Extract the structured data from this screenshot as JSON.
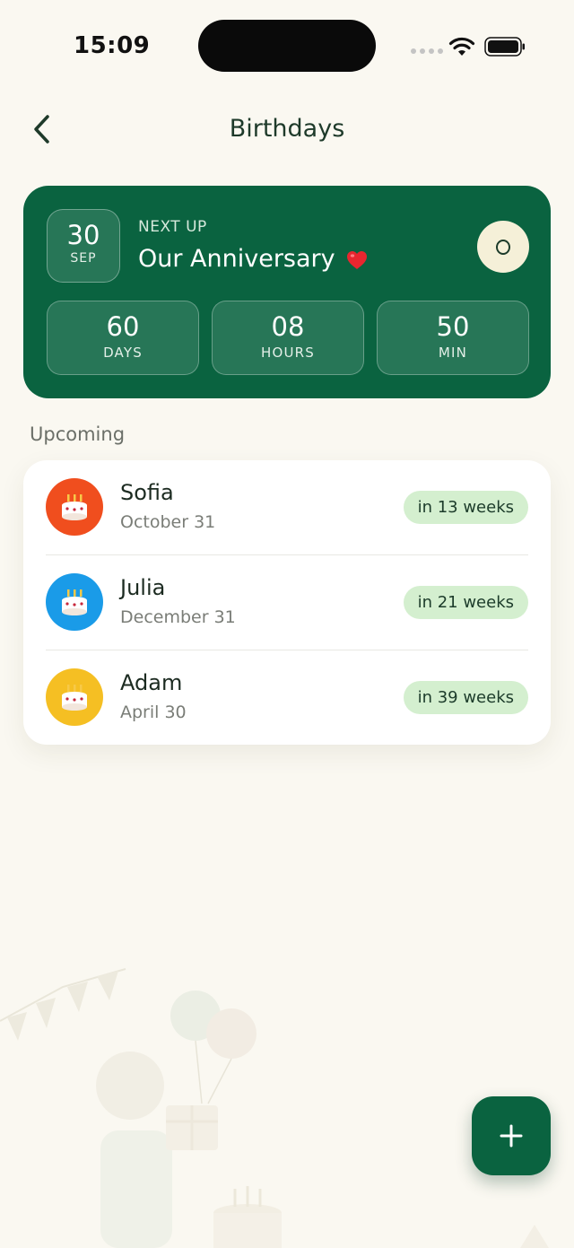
{
  "status_bar": {
    "time": "15:09"
  },
  "header": {
    "title": "Birthdays",
    "back_icon": "chevron-left-icon"
  },
  "next_up": {
    "day": "30",
    "month": "SEP",
    "label": "NEXT UP",
    "title": "Our Anniversary",
    "title_emoji": "heart-icon",
    "countdown": [
      {
        "value": "60",
        "unit": "DAYS"
      },
      {
        "value": "08",
        "unit": "HOURS"
      },
      {
        "value": "50",
        "unit": "MIN"
      }
    ]
  },
  "upcoming": {
    "label": "Upcoming",
    "items": [
      {
        "name": "Sofia",
        "date": "October 31",
        "badge": "in 13 weeks",
        "avatar_color": "#f04e1e"
      },
      {
        "name": "Julia",
        "date": "December 31",
        "badge": "in 21 weeks",
        "avatar_color": "#1a9be8"
      },
      {
        "name": "Adam",
        "date": "April 30",
        "badge": "in 39 weeks",
        "avatar_color": "#f5bf23"
      }
    ]
  },
  "colors": {
    "primary": "#0a6340",
    "background": "#faf8f1",
    "badge": "#d4efcf"
  },
  "fab": {
    "icon": "plus-icon"
  }
}
